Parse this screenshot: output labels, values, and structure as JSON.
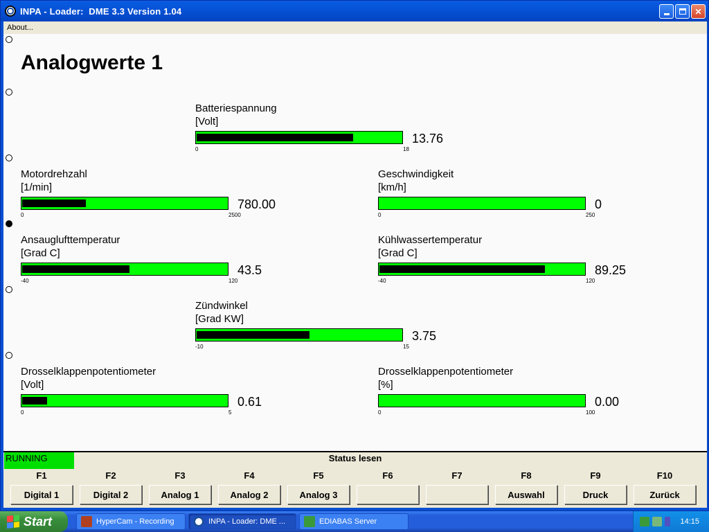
{
  "window": {
    "title": "INPA - Loader:  DME 3.3 Version 1.04"
  },
  "menu": {
    "about": "About..."
  },
  "page_title": "Analogwerte 1",
  "gauges": [
    {
      "label": "Batteriespannung",
      "unit": "[Volt]",
      "value": "13.76",
      "min": "0",
      "max": "18",
      "fraction": 0.764
    },
    {
      "label": "Motordrehzahl",
      "unit": "[1/min]",
      "value": "780.00",
      "min": "0",
      "max": "2500",
      "fraction": 0.312
    },
    {
      "label": "Geschwindigkeit",
      "unit": "[km/h]",
      "value": "0",
      "min": "0",
      "max": "250",
      "fraction": 0.0
    },
    {
      "label": "Ansauglufttemperatur",
      "unit": "[Grad C]",
      "value": "43.5",
      "min": "-40",
      "max": "120",
      "fraction": 0.522
    },
    {
      "label": "Kühlwassertemperatur",
      "unit": "[Grad C]",
      "value": "89.25",
      "min": "-40",
      "max": "120",
      "fraction": 0.808
    },
    {
      "label": "Zündwinkel",
      "unit": "[Grad KW]",
      "value": "3.75",
      "min": "-10",
      "max": "15",
      "fraction": 0.55
    },
    {
      "label": "Drosselklappenpotentiometer",
      "unit": "[Volt]",
      "value": "0.61",
      "min": "0",
      "max": "5",
      "fraction": 0.122
    },
    {
      "label": "Drosselklappenpotentiometer",
      "unit": "[%]",
      "value": "0.00",
      "min": "0",
      "max": "100",
      "fraction": 0.0
    }
  ],
  "status": {
    "running": "RUNNING",
    "title": "Status lesen"
  },
  "fkeys": [
    {
      "key": "F1",
      "label": "Digital 1"
    },
    {
      "key": "F2",
      "label": "Digital 2"
    },
    {
      "key": "F3",
      "label": "Analog 1"
    },
    {
      "key": "F4",
      "label": "Analog 2"
    },
    {
      "key": "F5",
      "label": "Analog 3"
    },
    {
      "key": "F6",
      "label": ""
    },
    {
      "key": "F7",
      "label": ""
    },
    {
      "key": "F8",
      "label": "Auswahl"
    },
    {
      "key": "F9",
      "label": "Druck"
    },
    {
      "key": "F10",
      "label": "Zurück"
    }
  ],
  "taskbar": {
    "start": "Start",
    "tasks": [
      "HyperCam - Recording",
      "INPA - Loader:  DME ...",
      "EDIABAS Server"
    ],
    "clock": "14:15"
  },
  "colors": {
    "bar_green": "#00ff00",
    "running_green": "#00e000",
    "title_blue": "#0653d8"
  }
}
